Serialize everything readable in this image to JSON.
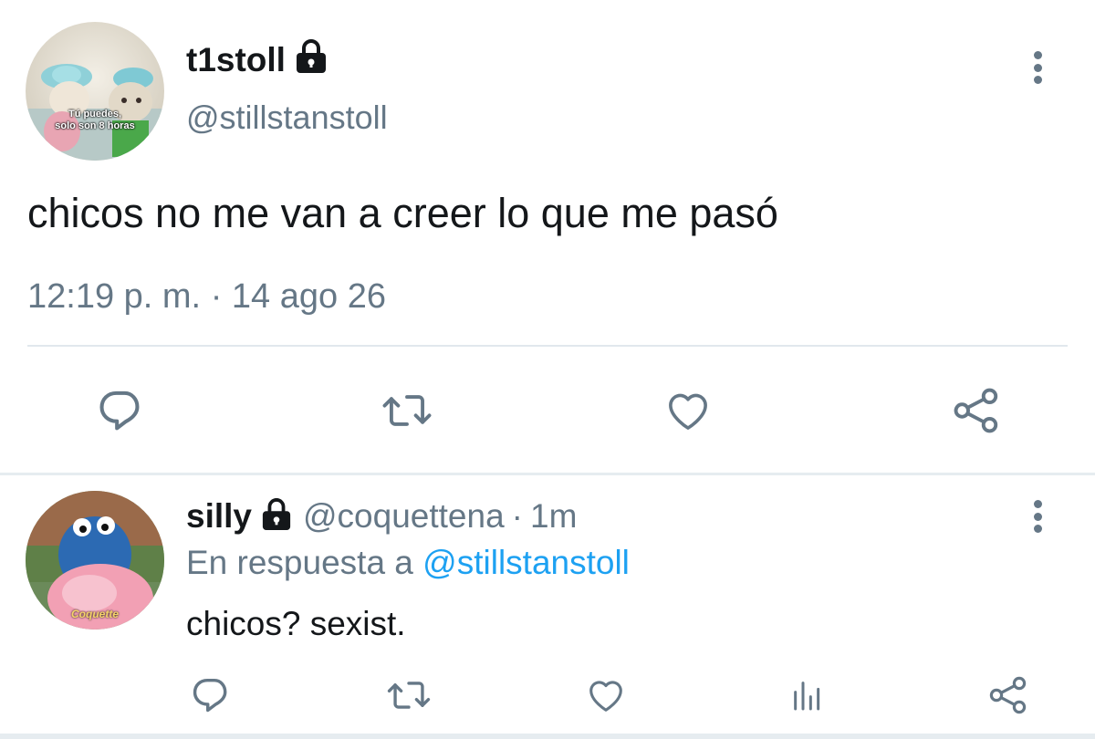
{
  "tweet": {
    "avatar_caption_line1": "Tú puedes,",
    "avatar_caption_line2": "solo son 8 horas",
    "display_name": "t1stoll",
    "handle": "@stillstanstoll",
    "text": "chicos no me van a creer lo que me pasó",
    "time": "12:19 p. m.",
    "separator": "·",
    "date": "14 ago 26",
    "locked": true,
    "actions": [
      "comment-icon",
      "retweet-icon",
      "like-icon",
      "share-icon"
    ]
  },
  "reply": {
    "avatar_caption": "Coquette",
    "display_name": "silly",
    "handle": "@coquettena",
    "separator": "·",
    "age": "1m",
    "reply_prefix": "En respuesta a",
    "reply_to": "@stillstanstoll",
    "text": "chicos? sexist.",
    "locked": true,
    "actions": [
      "comment-icon",
      "retweet-icon",
      "like-icon",
      "analytics-icon",
      "share-icon"
    ]
  },
  "colors": {
    "text": "#14171a",
    "secondary": "#657786",
    "link": "#1da1f2",
    "divider": "#e1e8ed"
  }
}
